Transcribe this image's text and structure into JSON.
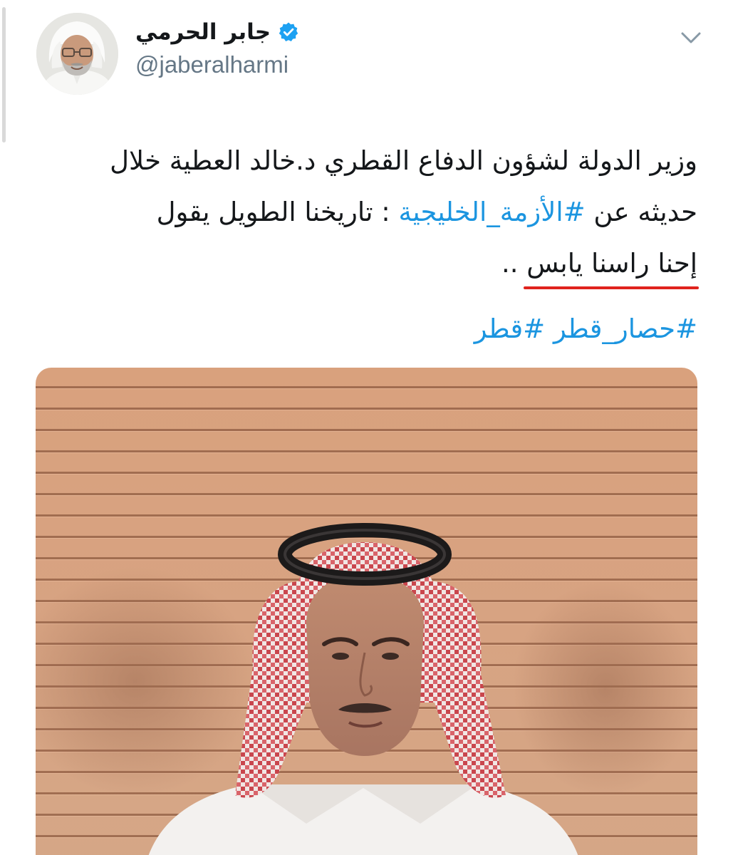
{
  "tweet": {
    "author": {
      "display_name": "جابر الحرمي",
      "handle": "@jaberalharmi",
      "verified": true,
      "avatar_icon": "profile-avatar"
    },
    "menu_icon": "chevron-down-icon",
    "text": {
      "line1": "وزير الدولة لشؤون الدفاع القطري د.خالد العطية خلال",
      "line2_before": "حديثه عن ",
      "line2_hashtag": "#الأزمة_الخليجية",
      "line2_after": " : تاريخنا الطويل يقول",
      "line3_underlined": "إحنا راسنا يابس",
      "line3_after": " .."
    },
    "hashtags": [
      "#حصار_قطر",
      "#قطر"
    ],
    "media": {
      "type": "photo",
      "icon": "tweet-photo"
    },
    "colors": {
      "link": "#1b95e0",
      "verified": "#1da1f2",
      "underline": "#e0231d",
      "text": "#14171a",
      "handle": "#657786"
    }
  }
}
